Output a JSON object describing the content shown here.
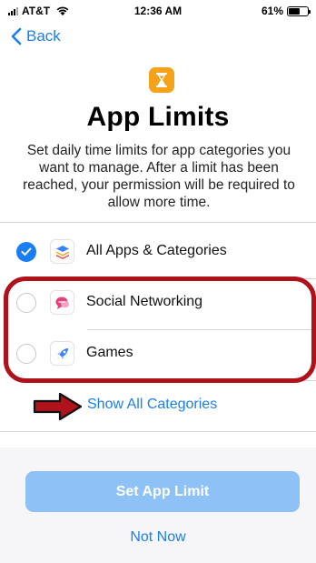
{
  "status_bar": {
    "carrier": "AT&T",
    "time": "12:36 AM",
    "battery": "61%",
    "battery_level": 0.61
  },
  "nav": {
    "back_label": "Back"
  },
  "header": {
    "icon": "hourglass-icon",
    "title": "App Limits",
    "description": "Set daily time limits for app categories you want to manage. After a limit has been reached, your permission will be required to allow more time."
  },
  "categories": [
    {
      "label": "All Apps & Categories",
      "icon": "stack-icon",
      "selected": true
    },
    {
      "label": "Social Networking",
      "icon": "chat-bubble-icon",
      "selected": false
    },
    {
      "label": "Games",
      "icon": "rocket-icon",
      "selected": false
    }
  ],
  "show_all_label": "Show All Categories",
  "buttons": {
    "set_limit_label": "Set App Limit",
    "not_now_label": "Not Now"
  },
  "colors": {
    "accent": "#1a7ef3",
    "disabled_button": "#8ec2f6",
    "hourglass_bg": "#f5a21b",
    "annotation": "#b0121b"
  }
}
